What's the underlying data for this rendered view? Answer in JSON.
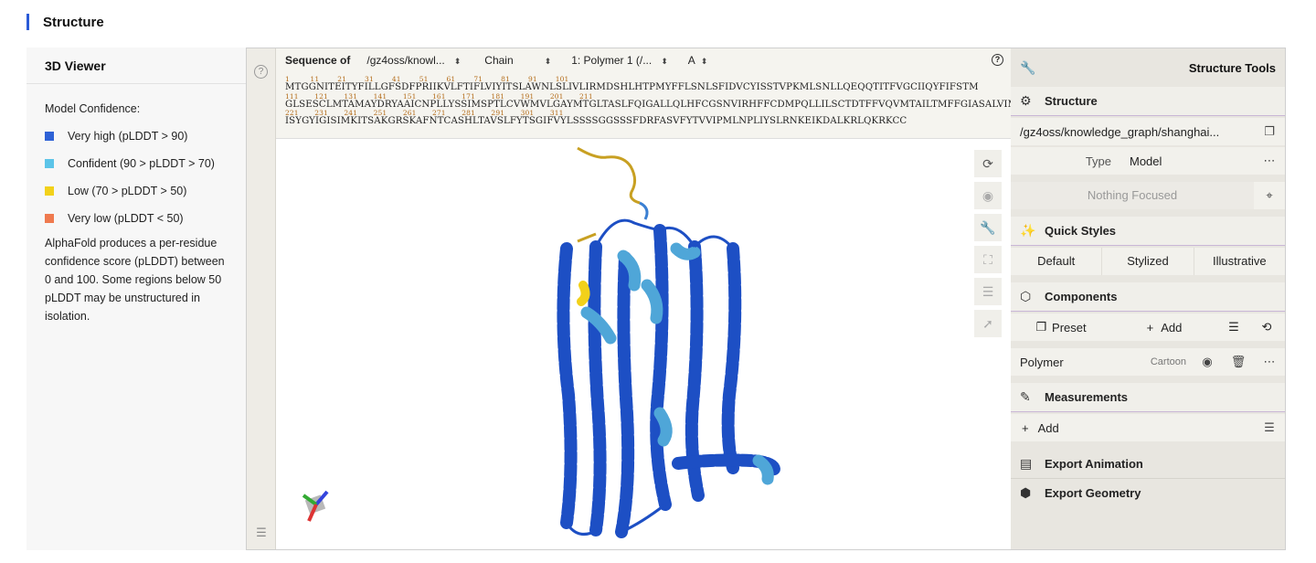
{
  "section": {
    "title": "Structure"
  },
  "info": {
    "panel_title": "3D Viewer",
    "confidence_title": "Model Confidence:",
    "legend": [
      {
        "label": "Very high (pLDDT > 90)",
        "color": "#2e62d6"
      },
      {
        "label": "Confident (90 > pLDDT > 70)",
        "color": "#5cc4e8"
      },
      {
        "label": "Low (70 > pLDDT > 50)",
        "color": "#f2d11a"
      },
      {
        "label": "Very low (pLDDT < 50)",
        "color": "#ef7a4f"
      }
    ],
    "description": "AlphaFold produces a per-residue confidence score (pLDDT) between 0 and 100. Some regions below 50 pLDDT may be unstructured in isolation."
  },
  "sequence": {
    "label": "Sequence of",
    "source": "/gz4oss/knowl...",
    "mode": "Chain",
    "polymer": "1: Polymer 1 (/...",
    "chain": "A",
    "help": "?",
    "rows": [
      {
        "nums": "1         11        21        31        41        51        61        71        81        91        101",
        "seq": "MTGGNITEITYFILLGFSDFPRIIKVLFTIFLVIYITSLAWNLSLIVLIRMDSHLHTPMYFFLSNLSFIDVCYISSTVPKMLSNLLQEQQTITFVGCIIQYFIFSTM"
      },
      {
        "nums": "111       121       131       141       151       161       171       181       191       201       211",
        "seq": "GLSESCLMTAMAYDRYAAICNPLLYSSIMSPTLCVWMVLGAYMTGLTASLFQIGALLQLHFCGSNVIRHFFCDMPQLLILSCTDTFFVQVMTAILTMFFGIASALVIM"
      },
      {
        "nums": "221       231       241       251       261       271       281       291       301       311",
        "seq": "ISYGYIGISIMKITSAKGRSKAFNTCASHLTAVSLFYTSGIFVYLSSSSGGSSSFDRFASVFYTVVIPMLNPLIYSLRNKEIKDALKRLQKRKCC"
      }
    ]
  },
  "tools": {
    "title": "Structure Tools",
    "structure": {
      "title": "Structure",
      "path": "/gz4oss/knowledge_graph/shanghai...",
      "type_label": "Type",
      "type_value": "Model",
      "focus": "Nothing Focused"
    },
    "quick_styles": {
      "title": "Quick Styles",
      "options": [
        "Default",
        "Stylized",
        "Illustrative"
      ]
    },
    "components": {
      "title": "Components",
      "preset": "Preset",
      "add": "Add",
      "polymer": "Polymer",
      "polymer_repr": "Cartoon"
    },
    "measurements": {
      "title": "Measurements",
      "add": "Add"
    },
    "export_animation": "Export Animation",
    "export_geometry": "Export Geometry"
  }
}
